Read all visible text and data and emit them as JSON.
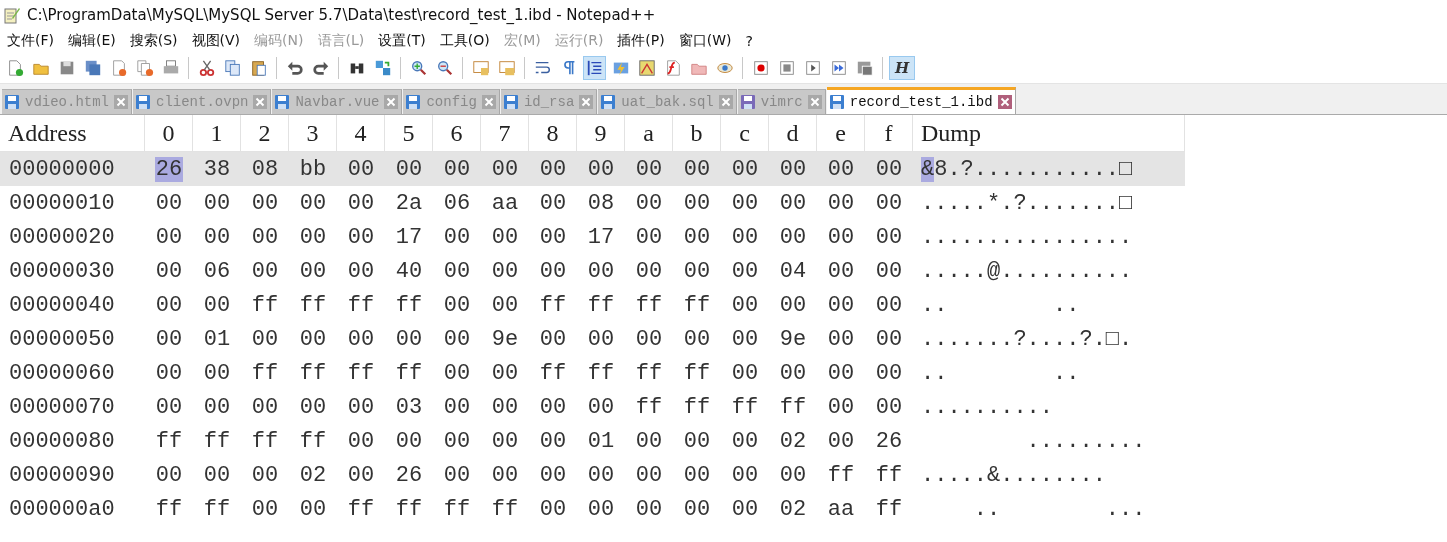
{
  "window": {
    "title": "C:\\ProgramData\\MySQL\\MySQL Server 5.7\\Data\\test\\record_test_1.ibd - Notepad++"
  },
  "menu": [
    {
      "label": "文件(F)",
      "disabled": false
    },
    {
      "label": "编辑(E)",
      "disabled": false
    },
    {
      "label": "搜索(S)",
      "disabled": false
    },
    {
      "label": "视图(V)",
      "disabled": false
    },
    {
      "label": "编码(N)",
      "disabled": true
    },
    {
      "label": "语言(L)",
      "disabled": true
    },
    {
      "label": "设置(T)",
      "disabled": false
    },
    {
      "label": "工具(O)",
      "disabled": false
    },
    {
      "label": "宏(M)",
      "disabled": true
    },
    {
      "label": "运行(R)",
      "disabled": true
    },
    {
      "label": "插件(P)",
      "disabled": false
    },
    {
      "label": "窗口(W)",
      "disabled": false
    },
    {
      "label": "?",
      "disabled": false
    }
  ],
  "toolbar": [
    {
      "kind": "button",
      "on": false
    },
    {
      "kind": "button",
      "on": false
    },
    {
      "kind": "button",
      "on": false
    },
    {
      "kind": "button",
      "on": false
    },
    {
      "kind": "button",
      "on": false
    },
    {
      "kind": "button",
      "on": false
    },
    {
      "kind": "button",
      "on": false
    },
    {
      "kind": "separator"
    },
    {
      "kind": "button",
      "on": false
    },
    {
      "kind": "button",
      "on": false
    },
    {
      "kind": "button",
      "on": false
    },
    {
      "kind": "separator"
    },
    {
      "kind": "button",
      "on": false
    },
    {
      "kind": "button",
      "on": false
    },
    {
      "kind": "separator"
    },
    {
      "kind": "button",
      "on": false
    },
    {
      "kind": "button",
      "on": false
    },
    {
      "kind": "separator"
    },
    {
      "kind": "button",
      "on": false
    },
    {
      "kind": "button",
      "on": false
    },
    {
      "kind": "separator"
    },
    {
      "kind": "button",
      "on": false
    },
    {
      "kind": "button",
      "on": false
    },
    {
      "kind": "separator"
    },
    {
      "kind": "button",
      "on": false
    },
    {
      "kind": "button",
      "on": false
    },
    {
      "kind": "button",
      "on": true
    },
    {
      "kind": "button",
      "on": false
    },
    {
      "kind": "button",
      "on": false
    },
    {
      "kind": "button",
      "on": false
    },
    {
      "kind": "button",
      "on": false
    },
    {
      "kind": "button",
      "on": false
    },
    {
      "kind": "separator"
    },
    {
      "kind": "button",
      "on": false
    },
    {
      "kind": "button",
      "on": false
    },
    {
      "kind": "button",
      "on": false
    },
    {
      "kind": "button",
      "on": false
    },
    {
      "kind": "button",
      "on": false
    },
    {
      "kind": "separator"
    },
    {
      "kind": "text",
      "on": true,
      "label": "H"
    }
  ],
  "tabs": [
    {
      "label": "vdieo.html",
      "selected": false,
      "color": "#3c7fd0"
    },
    {
      "label": "client.ovpn",
      "selected": false,
      "color": "#3c7fd0"
    },
    {
      "label": "Navbar.vue",
      "selected": false,
      "color": "#3c7fd0"
    },
    {
      "label": "config",
      "selected": false,
      "color": "#3c7fd0"
    },
    {
      "label": "id_rsa",
      "selected": false,
      "color": "#3c7fd0"
    },
    {
      "label": "uat_bak.sql",
      "selected": false,
      "color": "#3c7fd0"
    },
    {
      "label": "vimrc",
      "selected": false,
      "color": "#7a6ab8"
    },
    {
      "label": "record_test_1.ibd",
      "selected": true,
      "color": "#3c7fd0"
    }
  ],
  "grid": {
    "columns": [
      "Address",
      "0",
      "1",
      "2",
      "3",
      "4",
      "5",
      "6",
      "7",
      "8",
      "9",
      "a",
      "b",
      "c",
      "d",
      "e",
      "f",
      "Dump"
    ],
    "rows": [
      {
        "address": "00000000",
        "current": true,
        "bytes": [
          {
            "text": "26",
            "selected": true
          },
          {
            "text": "38",
            "selected": false
          },
          {
            "text": "08",
            "selected": false
          },
          {
            "text": "bb",
            "selected": false
          },
          {
            "text": "00",
            "selected": false
          },
          {
            "text": "00",
            "selected": false
          },
          {
            "text": "00",
            "selected": false
          },
          {
            "text": "00",
            "selected": false
          },
          {
            "text": "00",
            "selected": false
          },
          {
            "text": "00",
            "selected": false
          },
          {
            "text": "00",
            "selected": false
          },
          {
            "text": "00",
            "selected": false
          },
          {
            "text": "00",
            "selected": false
          },
          {
            "text": "00",
            "selected": false
          },
          {
            "text": "00",
            "selected": false
          },
          {
            "text": "00",
            "selected": false
          }
        ],
        "dump": [
          {
            "text": "&",
            "selected": true
          },
          {
            "text": "8.?...........□",
            "selected": false
          }
        ]
      },
      {
        "address": "00000010",
        "current": false,
        "bytes": [
          {
            "text": "00",
            "selected": false
          },
          {
            "text": "00",
            "selected": false
          },
          {
            "text": "00",
            "selected": false
          },
          {
            "text": "00",
            "selected": false
          },
          {
            "text": "00",
            "selected": false
          },
          {
            "text": "2a",
            "selected": false
          },
          {
            "text": "06",
            "selected": false
          },
          {
            "text": "aa",
            "selected": false
          },
          {
            "text": "00",
            "selected": false
          },
          {
            "text": "08",
            "selected": false
          },
          {
            "text": "00",
            "selected": false
          },
          {
            "text": "00",
            "selected": false
          },
          {
            "text": "00",
            "selected": false
          },
          {
            "text": "00",
            "selected": false
          },
          {
            "text": "00",
            "selected": false
          },
          {
            "text": "00",
            "selected": false
          }
        ],
        "dump": [
          {
            "text": ".....*.?.......□",
            "selected": false
          }
        ]
      },
      {
        "address": "00000020",
        "current": false,
        "bytes": [
          {
            "text": "00",
            "selected": false
          },
          {
            "text": "00",
            "selected": false
          },
          {
            "text": "00",
            "selected": false
          },
          {
            "text": "00",
            "selected": false
          },
          {
            "text": "00",
            "selected": false
          },
          {
            "text": "17",
            "selected": false
          },
          {
            "text": "00",
            "selected": false
          },
          {
            "text": "00",
            "selected": false
          },
          {
            "text": "00",
            "selected": false
          },
          {
            "text": "17",
            "selected": false
          },
          {
            "text": "00",
            "selected": false
          },
          {
            "text": "00",
            "selected": false
          },
          {
            "text": "00",
            "selected": false
          },
          {
            "text": "00",
            "selected": false
          },
          {
            "text": "00",
            "selected": false
          },
          {
            "text": "00",
            "selected": false
          }
        ],
        "dump": [
          {
            "text": "................",
            "selected": false
          }
        ]
      },
      {
        "address": "00000030",
        "current": false,
        "bytes": [
          {
            "text": "00",
            "selected": false
          },
          {
            "text": "06",
            "selected": false
          },
          {
            "text": "00",
            "selected": false
          },
          {
            "text": "00",
            "selected": false
          },
          {
            "text": "00",
            "selected": false
          },
          {
            "text": "40",
            "selected": false
          },
          {
            "text": "00",
            "selected": false
          },
          {
            "text": "00",
            "selected": false
          },
          {
            "text": "00",
            "selected": false
          },
          {
            "text": "00",
            "selected": false
          },
          {
            "text": "00",
            "selected": false
          },
          {
            "text": "00",
            "selected": false
          },
          {
            "text": "00",
            "selected": false
          },
          {
            "text": "04",
            "selected": false
          },
          {
            "text": "00",
            "selected": false
          },
          {
            "text": "00",
            "selected": false
          }
        ],
        "dump": [
          {
            "text": ".....@..........",
            "selected": false
          }
        ]
      },
      {
        "address": "00000040",
        "current": false,
        "bytes": [
          {
            "text": "00",
            "selected": false
          },
          {
            "text": "00",
            "selected": false
          },
          {
            "text": "ff",
            "selected": false
          },
          {
            "text": "ff",
            "selected": false
          },
          {
            "text": "ff",
            "selected": false
          },
          {
            "text": "ff",
            "selected": false
          },
          {
            "text": "00",
            "selected": false
          },
          {
            "text": "00",
            "selected": false
          },
          {
            "text": "ff",
            "selected": false
          },
          {
            "text": "ff",
            "selected": false
          },
          {
            "text": "ff",
            "selected": false
          },
          {
            "text": "ff",
            "selected": false
          },
          {
            "text": "00",
            "selected": false
          },
          {
            "text": "00",
            "selected": false
          },
          {
            "text": "00",
            "selected": false
          },
          {
            "text": "00",
            "selected": false
          }
        ],
        "dump": [
          {
            "text": "..        ..",
            "selected": false
          }
        ]
      },
      {
        "address": "00000050",
        "current": false,
        "bytes": [
          {
            "text": "00",
            "selected": false
          },
          {
            "text": "01",
            "selected": false
          },
          {
            "text": "00",
            "selected": false
          },
          {
            "text": "00",
            "selected": false
          },
          {
            "text": "00",
            "selected": false
          },
          {
            "text": "00",
            "selected": false
          },
          {
            "text": "00",
            "selected": false
          },
          {
            "text": "9e",
            "selected": false
          },
          {
            "text": "00",
            "selected": false
          },
          {
            "text": "00",
            "selected": false
          },
          {
            "text": "00",
            "selected": false
          },
          {
            "text": "00",
            "selected": false
          },
          {
            "text": "00",
            "selected": false
          },
          {
            "text": "9e",
            "selected": false
          },
          {
            "text": "00",
            "selected": false
          },
          {
            "text": "00",
            "selected": false
          }
        ],
        "dump": [
          {
            "text": ".......?....?.□.",
            "selected": false
          }
        ]
      },
      {
        "address": "00000060",
        "current": false,
        "bytes": [
          {
            "text": "00",
            "selected": false
          },
          {
            "text": "00",
            "selected": false
          },
          {
            "text": "ff",
            "selected": false
          },
          {
            "text": "ff",
            "selected": false
          },
          {
            "text": "ff",
            "selected": false
          },
          {
            "text": "ff",
            "selected": false
          },
          {
            "text": "00",
            "selected": false
          },
          {
            "text": "00",
            "selected": false
          },
          {
            "text": "ff",
            "selected": false
          },
          {
            "text": "ff",
            "selected": false
          },
          {
            "text": "ff",
            "selected": false
          },
          {
            "text": "ff",
            "selected": false
          },
          {
            "text": "00",
            "selected": false
          },
          {
            "text": "00",
            "selected": false
          },
          {
            "text": "00",
            "selected": false
          },
          {
            "text": "00",
            "selected": false
          }
        ],
        "dump": [
          {
            "text": "..        ..",
            "selected": false
          }
        ]
      },
      {
        "address": "00000070",
        "current": false,
        "bytes": [
          {
            "text": "00",
            "selected": false
          },
          {
            "text": "00",
            "selected": false
          },
          {
            "text": "00",
            "selected": false
          },
          {
            "text": "00",
            "selected": false
          },
          {
            "text": "00",
            "selected": false
          },
          {
            "text": "03",
            "selected": false
          },
          {
            "text": "00",
            "selected": false
          },
          {
            "text": "00",
            "selected": false
          },
          {
            "text": "00",
            "selected": false
          },
          {
            "text": "00",
            "selected": false
          },
          {
            "text": "ff",
            "selected": false
          },
          {
            "text": "ff",
            "selected": false
          },
          {
            "text": "ff",
            "selected": false
          },
          {
            "text": "ff",
            "selected": false
          },
          {
            "text": "00",
            "selected": false
          },
          {
            "text": "00",
            "selected": false
          }
        ],
        "dump": [
          {
            "text": "..........",
            "selected": false
          }
        ]
      },
      {
        "address": "00000080",
        "current": false,
        "bytes": [
          {
            "text": "ff",
            "selected": false
          },
          {
            "text": "ff",
            "selected": false
          },
          {
            "text": "ff",
            "selected": false
          },
          {
            "text": "ff",
            "selected": false
          },
          {
            "text": "00",
            "selected": false
          },
          {
            "text": "00",
            "selected": false
          },
          {
            "text": "00",
            "selected": false
          },
          {
            "text": "00",
            "selected": false
          },
          {
            "text": "00",
            "selected": false
          },
          {
            "text": "01",
            "selected": false
          },
          {
            "text": "00",
            "selected": false
          },
          {
            "text": "00",
            "selected": false
          },
          {
            "text": "00",
            "selected": false
          },
          {
            "text": "02",
            "selected": false
          },
          {
            "text": "00",
            "selected": false
          },
          {
            "text": "26",
            "selected": false
          }
        ],
        "dump": [
          {
            "text": "        .........",
            "selected": false
          }
        ]
      },
      {
        "address": "00000090",
        "current": false,
        "bytes": [
          {
            "text": "00",
            "selected": false
          },
          {
            "text": "00",
            "selected": false
          },
          {
            "text": "00",
            "selected": false
          },
          {
            "text": "02",
            "selected": false
          },
          {
            "text": "00",
            "selected": false
          },
          {
            "text": "26",
            "selected": false
          },
          {
            "text": "00",
            "selected": false
          },
          {
            "text": "00",
            "selected": false
          },
          {
            "text": "00",
            "selected": false
          },
          {
            "text": "00",
            "selected": false
          },
          {
            "text": "00",
            "selected": false
          },
          {
            "text": "00",
            "selected": false
          },
          {
            "text": "00",
            "selected": false
          },
          {
            "text": "00",
            "selected": false
          },
          {
            "text": "ff",
            "selected": false
          },
          {
            "text": "ff",
            "selected": false
          }
        ],
        "dump": [
          {
            "text": ".....&........",
            "selected": false
          }
        ]
      },
      {
        "address": "000000a0",
        "current": false,
        "bytes": [
          {
            "text": "ff",
            "selected": false
          },
          {
            "text": "ff",
            "selected": false
          },
          {
            "text": "00",
            "selected": false
          },
          {
            "text": "00",
            "selected": false
          },
          {
            "text": "ff",
            "selected": false
          },
          {
            "text": "ff",
            "selected": false
          },
          {
            "text": "ff",
            "selected": false
          },
          {
            "text": "ff",
            "selected": false
          },
          {
            "text": "00",
            "selected": false
          },
          {
            "text": "00",
            "selected": false
          },
          {
            "text": "00",
            "selected": false
          },
          {
            "text": "00",
            "selected": false
          },
          {
            "text": "00",
            "selected": false
          },
          {
            "text": "02",
            "selected": false
          },
          {
            "text": "aa",
            "selected": false
          },
          {
            "text": "ff",
            "selected": false
          }
        ],
        "dump": [
          {
            "text": "    ..        ...",
            "selected": false
          }
        ]
      }
    ]
  }
}
